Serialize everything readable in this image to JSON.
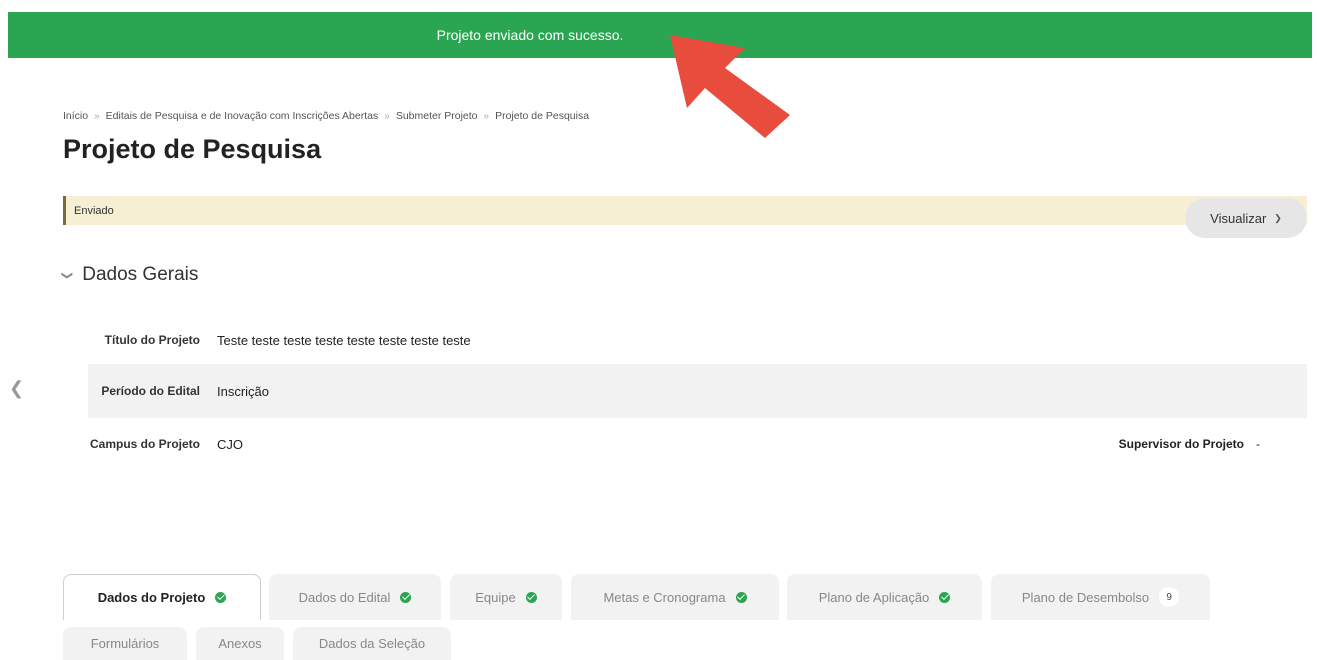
{
  "alert": {
    "message": "Projeto enviado com sucesso."
  },
  "breadcrumb": [
    "Início",
    "Editais de Pesquisa e de Inovação com Inscrições Abertas",
    "Submeter Projeto",
    "Projeto de Pesquisa"
  ],
  "breadcrumb_separator": "»",
  "page_title": "Projeto de Pesquisa",
  "status": "Enviado",
  "visualizar_label": "Visualizar",
  "section": {
    "title": "Dados Gerais"
  },
  "fields": {
    "titulo_label": "Título do Projeto",
    "titulo_value": "Teste teste teste teste teste teste teste teste",
    "periodo_label": "Período do Edital",
    "periodo_value": "Inscrição",
    "campus_label": "Campus do Projeto",
    "campus_value": "CJO",
    "supervisor_label": "Supervisor do Projeto",
    "supervisor_value": "-"
  },
  "tabs": [
    {
      "label": "Dados do Projeto",
      "active": true,
      "status": "ok"
    },
    {
      "label": "Dados do Edital",
      "status": "ok"
    },
    {
      "label": "Equipe",
      "status": "ok"
    },
    {
      "label": "Metas e Cronograma",
      "status": "ok"
    },
    {
      "label": "Plano de Aplicação",
      "status": "ok"
    },
    {
      "label": "Plano de Desembolso",
      "count": "9"
    },
    {
      "label": "Formulários"
    },
    {
      "label": "Anexos"
    },
    {
      "label": "Dados da Seleção"
    }
  ],
  "colors": {
    "success": "#2aa652",
    "status_bg": "#f6efd3",
    "pointer": "#e74c3c"
  }
}
